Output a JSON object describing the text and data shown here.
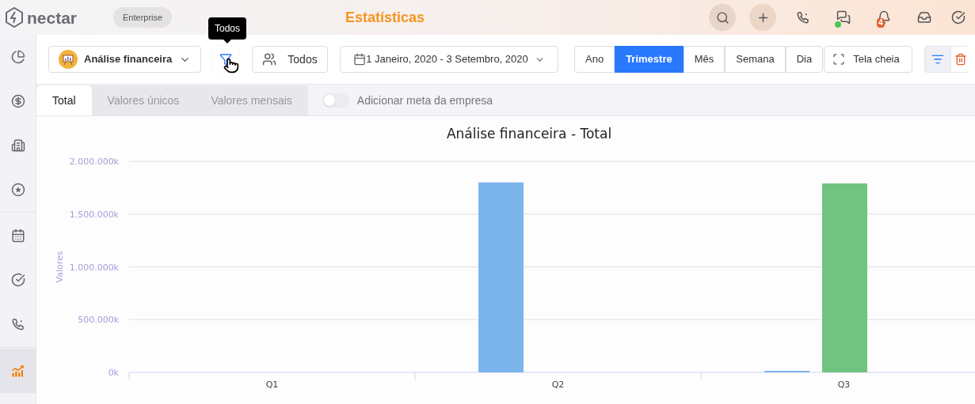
{
  "header": {
    "logo": "nectar",
    "plan_badge": "Enterprise",
    "title": "Estatísticas",
    "notification_count": "4",
    "chat_online": true
  },
  "sidebar": {
    "sections": [
      {
        "items": [
          {
            "selected": false
          },
          {
            "selected": false
          },
          {
            "selected": false
          },
          {
            "selected": false
          }
        ]
      },
      {
        "items": [
          {
            "selected": false
          },
          {
            "selected": false
          },
          {
            "selected": false
          }
        ]
      },
      {
        "items": [
          {
            "selected": true
          }
        ]
      }
    ]
  },
  "toolbar": {
    "report": "Análise financeira",
    "tooltip": "Todos",
    "users": "Todos",
    "date_range": "1 Janeiro, 2020 - 3 Setembro, 2020",
    "periods": [
      {
        "label": "Ano",
        "selected": false
      },
      {
        "label": "Trimestre",
        "selected": true
      },
      {
        "label": "Mês",
        "selected": false
      },
      {
        "label": "Semana",
        "selected": false
      },
      {
        "label": "Dia",
        "selected": false
      }
    ],
    "fullscreen": "Tela cheia",
    "list_filter_selected": true
  },
  "tabs": [
    {
      "label": "Total",
      "selected": true
    },
    {
      "label": "Valores únicos",
      "selected": false
    },
    {
      "label": "Valores mensais",
      "selected": false
    }
  ],
  "company_goal_toggle": {
    "label": "Adicionar meta da empresa",
    "on": false
  },
  "chart": {
    "chart_data": {
      "type": "bar",
      "title": "Análise financeira - Total",
      "ylabel": "Valores",
      "categories": [
        "Q1",
        "Q2",
        "Q3"
      ],
      "series": [
        {
          "color": "#7cb5ec",
          "values": [
            0,
            1800000,
            15000
          ]
        },
        {
          "color": "#71c480",
          "values": [
            0,
            0,
            1790000
          ]
        }
      ],
      "ylim": [
        0,
        2000000
      ],
      "grid": true,
      "yticks": [
        {
          "value": 0,
          "label": "0k"
        },
        {
          "value": 500000,
          "label": "500.000k"
        },
        {
          "value": 1000000,
          "label": "1.000.000k"
        },
        {
          "value": 1500000,
          "label": "1.500.000k"
        },
        {
          "value": 2000000,
          "label": "2.000.000k"
        }
      ]
    }
  }
}
